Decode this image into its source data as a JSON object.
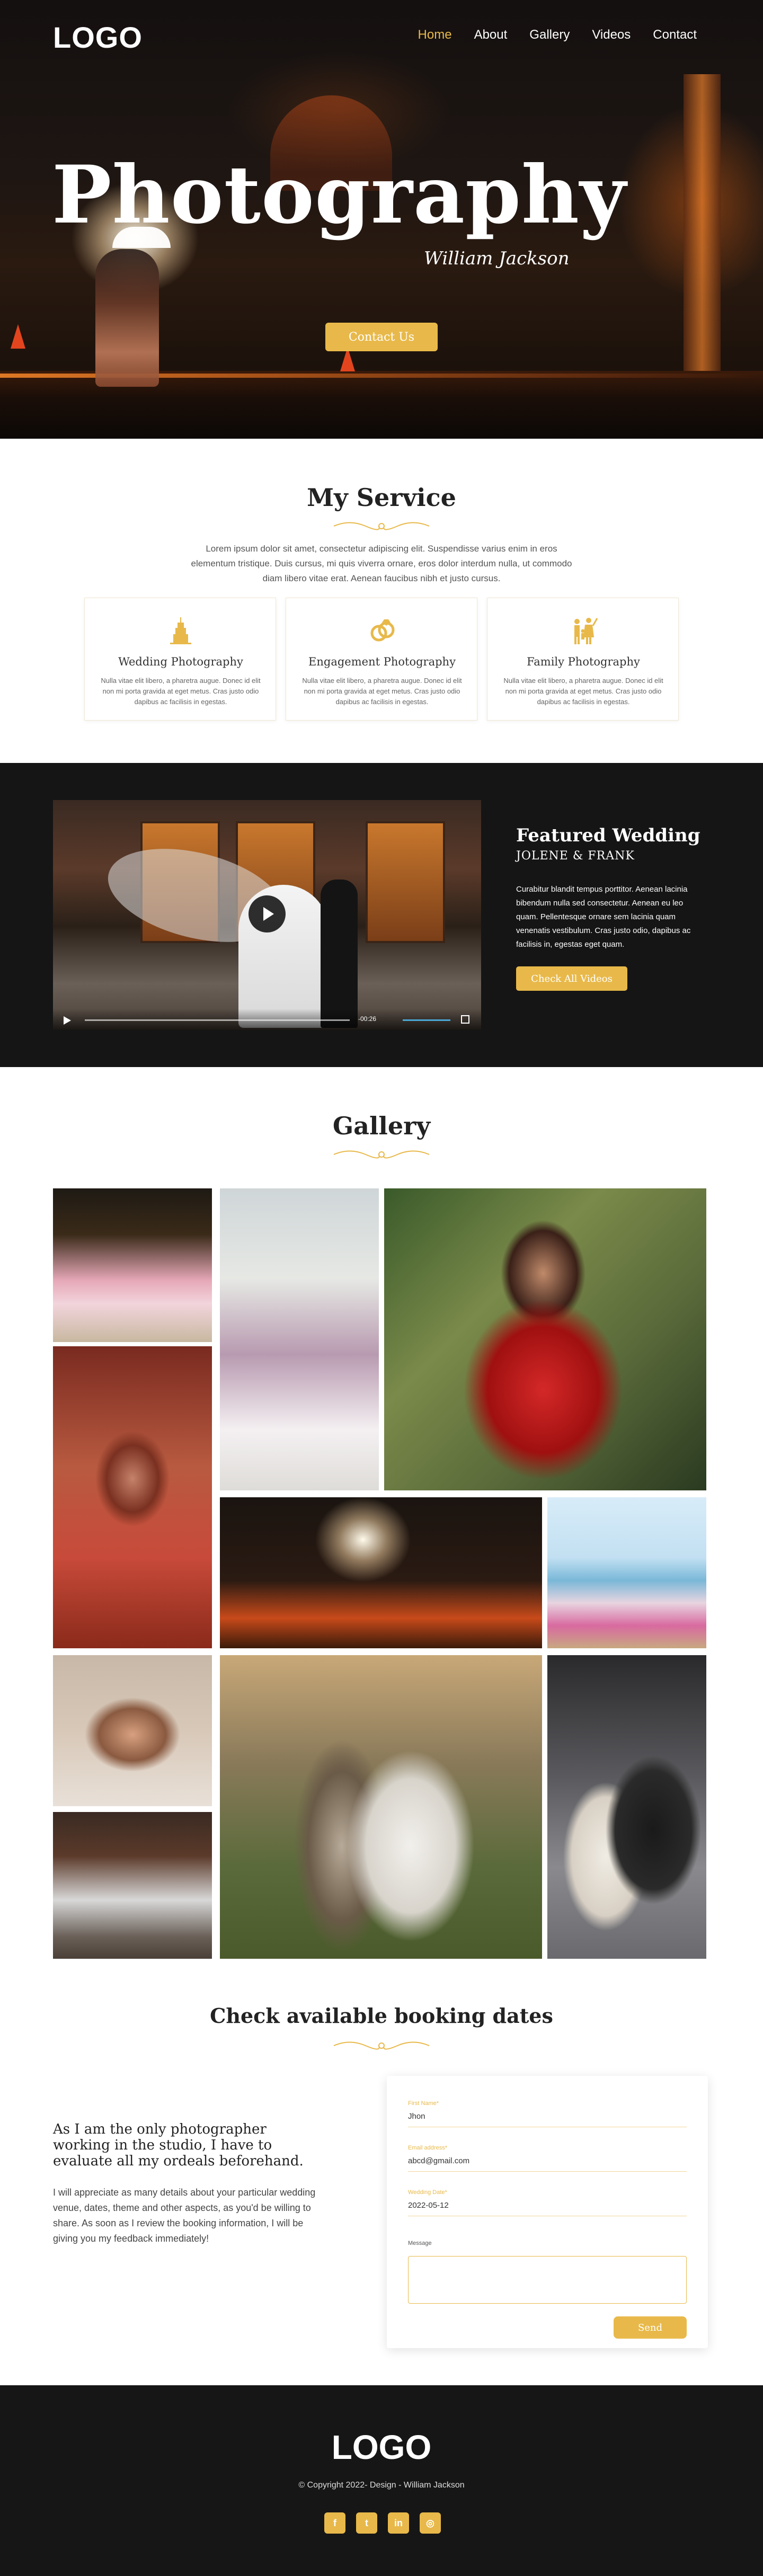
{
  "nav": {
    "logo": "LOGO",
    "items": [
      {
        "label": "Home",
        "active": true
      },
      {
        "label": "About"
      },
      {
        "label": "Gallery"
      },
      {
        "label": "Videos"
      },
      {
        "label": "Contact"
      }
    ]
  },
  "hero": {
    "title": "Photography",
    "subtitle": "William Jackson",
    "button": "Contact Us"
  },
  "service": {
    "title": "My Service",
    "text": "Lorem ipsum dolor sit amet, consectetur adipiscing elit. Suspendisse varius enim in eros elementum tristique. Duis cursus, mi quis viverra ornare, eros dolor interdum nulla, ut commodo diam libero vitae erat. Aenean faucibus nibh et justo cursus.",
    "cards": [
      {
        "icon": "cake-icon",
        "title": "Wedding Photography",
        "text": "Nulla vitae elit libero, a pharetra augue. Donec id elit non mi porta gravida at eget metus. Cras justo odio dapibus ac facilisis in egestas."
      },
      {
        "icon": "rings-icon",
        "title": "Engagement Photography",
        "text": "Nulla vitae elit libero, a pharetra augue. Donec id elit non mi porta gravida at eget metus. Cras justo odio dapibus ac facilisis in egestas."
      },
      {
        "icon": "family-icon",
        "title": "Family Photography",
        "text": "Nulla vitae elit libero, a pharetra augue. Donec id elit non mi porta gravida at eget metus. Cras justo odio dapibus ac facilisis in egestas."
      }
    ]
  },
  "featured": {
    "title": "Featured Wedding",
    "subtitle": "JOLENE & FRANK",
    "text": "Curabitur blandit tempus porttitor. Aenean lacinia bibendum nulla sed consectetur. Aenean eu leo quam. Pellentesque ornare sem lacinia quam venenatis vestibulum. Cras justo odio, dapibus ac facilisis in, egestas eget quam.",
    "button": "Check All Videos",
    "video_time": "-00:26"
  },
  "gallery": {
    "title": "Gallery"
  },
  "booking": {
    "title": "Check available booking dates",
    "heading": "As I am the only photographer working in the studio, I have to evaluate all my ordeals beforehand.",
    "text": "I will appreciate as many details about your particular wedding venue, dates, theme and other aspects, as you'd be willing to share. As soon as I review the booking information, I will be giving you my feedback immediately!",
    "form": {
      "name_label": "First Name*",
      "name_value": "Jhon",
      "email_label": "Email address*",
      "email_value": "abcd@gmail.com",
      "date_label": "Wedding Date*",
      "date_value": "2022-05-12",
      "message_label": "Message",
      "send": "Send"
    }
  },
  "footer": {
    "logo": "LOGO",
    "copyright": "© Copyright 2022- Design - William Jackson",
    "socials": [
      {
        "icon": "facebook-icon",
        "glyph": "f"
      },
      {
        "icon": "twitter-icon",
        "glyph": "t"
      },
      {
        "icon": "linkedin-icon",
        "glyph": "in"
      },
      {
        "icon": "instagram-icon",
        "glyph": "◎"
      }
    ]
  },
  "colors": {
    "accent": "#e8b94a",
    "dark": "#151515"
  }
}
